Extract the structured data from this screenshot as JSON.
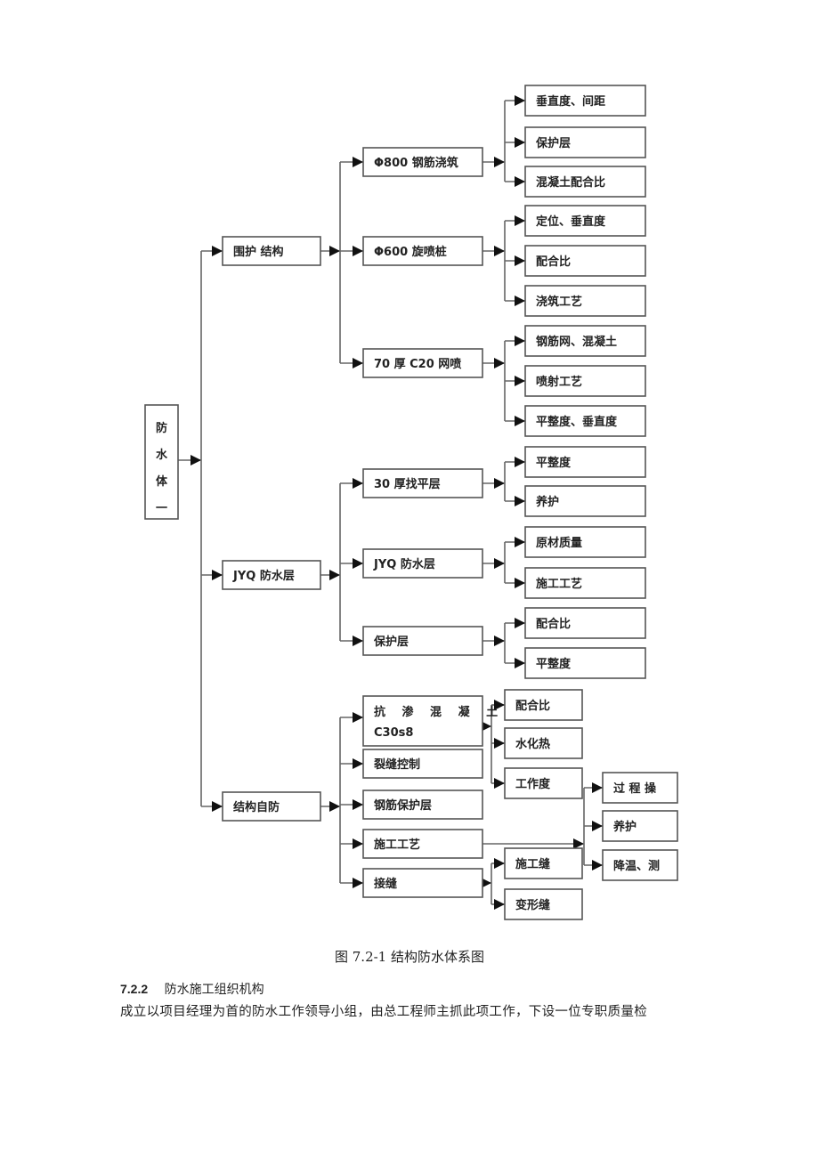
{
  "diagram": {
    "root": {
      "label": "防水体系",
      "visible_chars": [
        "防",
        "水",
        "体",
        "一"
      ]
    },
    "branches": [
      {
        "label": "围护 结构",
        "children": [
          {
            "label": "Φ800 钢筋浇筑",
            "children": [
              "垂直度、间距",
              "保护层",
              "混凝土配合比"
            ]
          },
          {
            "label": "Φ600 旋喷桩",
            "children": [
              "定位、垂直度",
              "配合比",
              "浇筑工艺"
            ]
          },
          {
            "label": "70 厚 C20 网喷",
            "children": [
              "钢筋网、混凝土",
              "喷射工艺",
              "平整度、垂直度"
            ]
          }
        ]
      },
      {
        "label": "JYQ 防水层",
        "children": [
          {
            "label": "30 厚找平层",
            "children": [
              "平整度",
              "养护"
            ]
          },
          {
            "label": "JYQ 防水层",
            "children": [
              "原材质量",
              "施工工艺"
            ]
          },
          {
            "label": "保护层",
            "children": [
              "配合比",
              "平整度"
            ]
          }
        ]
      },
      {
        "label": "结构自防",
        "children": [
          {
            "label_line1": "抗 渗 混 凝 土",
            "label_line2": "C30s8",
            "children": [
              "配合比",
              "水化热",
              "工作度"
            ]
          },
          {
            "label": "裂缝控制",
            "children": []
          },
          {
            "label": "钢筋保护层",
            "children": []
          },
          {
            "label": "施工工艺",
            "children": [
              "过 程 操",
              "养护",
              "降温、测"
            ]
          },
          {
            "label": "接缝",
            "children": [
              "施工缝",
              "变形缝"
            ]
          }
        ]
      }
    ]
  },
  "caption": "图 7.2-1 结构防水体系图",
  "section": {
    "number": "7.2.2",
    "title": "防水施工组织机构"
  },
  "body_text": "成立以项目经理为首的防水工作领导小组，由总工程师主抓此项工作，下设一位专职质量检"
}
